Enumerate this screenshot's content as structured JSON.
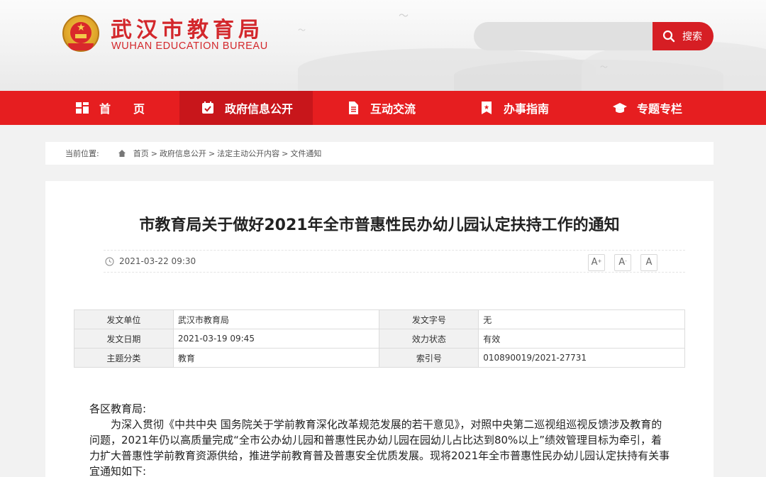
{
  "site": {
    "title_cn": "武汉市教育局",
    "title_en": "WUHAN EDUCATION BUREAU",
    "search_placeholder": "",
    "search_label": "搜索"
  },
  "nav": {
    "items": [
      {
        "label": "首　　页",
        "icon": "home-grid-icon"
      },
      {
        "label": "政府信息公开",
        "icon": "calendar-check-icon",
        "active": true
      },
      {
        "label": "互动交流",
        "icon": "document-icon"
      },
      {
        "label": "办事指南",
        "icon": "bookmark-star-icon"
      },
      {
        "label": "专题专栏",
        "icon": "graduation-cap-icon"
      }
    ]
  },
  "breadcrumb": {
    "lead": "当前位置:",
    "items": [
      "首页",
      "政府信息公开",
      "法定主动公开内容",
      "文件通知"
    ],
    "separator": ">"
  },
  "article": {
    "title": "市教育局关于做好2021年全市普惠性民办幼儿园认定扶持工作的通知",
    "date": "2021-03-22 09:30",
    "font_buttons": [
      "A+",
      "A-",
      "A"
    ],
    "meta_rows": [
      {
        "l1": "发文单位",
        "v1": "武汉市教育局",
        "l2": "发文字号",
        "v2": "无"
      },
      {
        "l1": "发文日期",
        "v1": "2021-03-19 09:45",
        "l2": "效力状态",
        "v2": "有效"
      },
      {
        "l1": "主题分类",
        "v1": "教育",
        "l2": "索引号",
        "v2": "010890019/2021-27731"
      }
    ],
    "salutation": "各区教育局:",
    "paragraph": "为深入贯彻《中共中央 国务院关于学前教育深化改革规范发展的若干意见》，对照中央第二巡视组巡视反馈涉及教育的问题，2021年仍以高质量完成“全市公办幼儿园和普惠性民办幼儿园在园幼儿占比达到80%以上”绩效管理目标为牵引，着力扩大普惠性学前教育资源供给，推进学前教育普及普惠安全优质发展。现将2021年全市普惠性民办幼儿园认定扶持有关事宜通知如下:"
  },
  "colors": {
    "brand_red": "#e61e20",
    "nav_active": "#c8161b",
    "title_red": "#d3282c"
  }
}
